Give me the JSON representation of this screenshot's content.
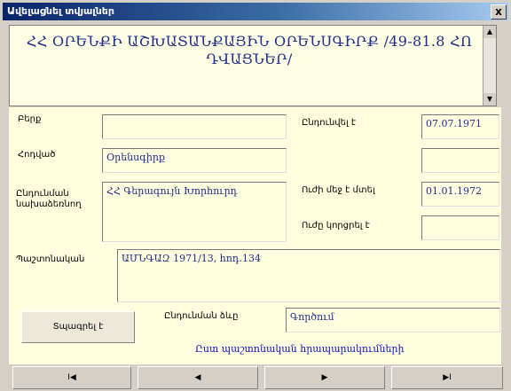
{
  "window": {
    "title": "Ավելացնել տվյալներ",
    "close_label": "x"
  },
  "header": {
    "text": "ՀՀ ՕՐԵՆՔԻ ԱՇԽԱՏԱՆՔԱՅԻՆ ՕՐԵՆՍԳԻՐՔ /49-81.8 ՀՈ ԴՎԱՑՆԵՐ/"
  },
  "form": {
    "left_labels": [
      "Բերք",
      "Հոդված",
      "Ընդունման նախաձեռնող",
      "Պաշտոնական"
    ],
    "field1": "",
    "field2": "Օրենսգիրք",
    "field3": "ՀՀ Գերագույն Խորհուրդ",
    "field4": "ԱՄՆԳԱԶ 1971/13, հոդ.134",
    "right_labels": [
      "Ընդունվել է",
      "Ուժի մեջ է մտել",
      "Ուժը կորցրել է"
    ],
    "date_adopted": "07.07.1971",
    "date_r2": "",
    "date_effective": "01.01.1972",
    "date_lost": "",
    "bottom_button": "Տպագրել է",
    "status_label": "Ընդունման ձևը",
    "status_value": "Գործում",
    "link": "Ըստ պաշտոնական հրապարակումների"
  },
  "nav": {
    "first": "I◀",
    "prev": "◀",
    "next": "▶",
    "last": "▶I"
  }
}
